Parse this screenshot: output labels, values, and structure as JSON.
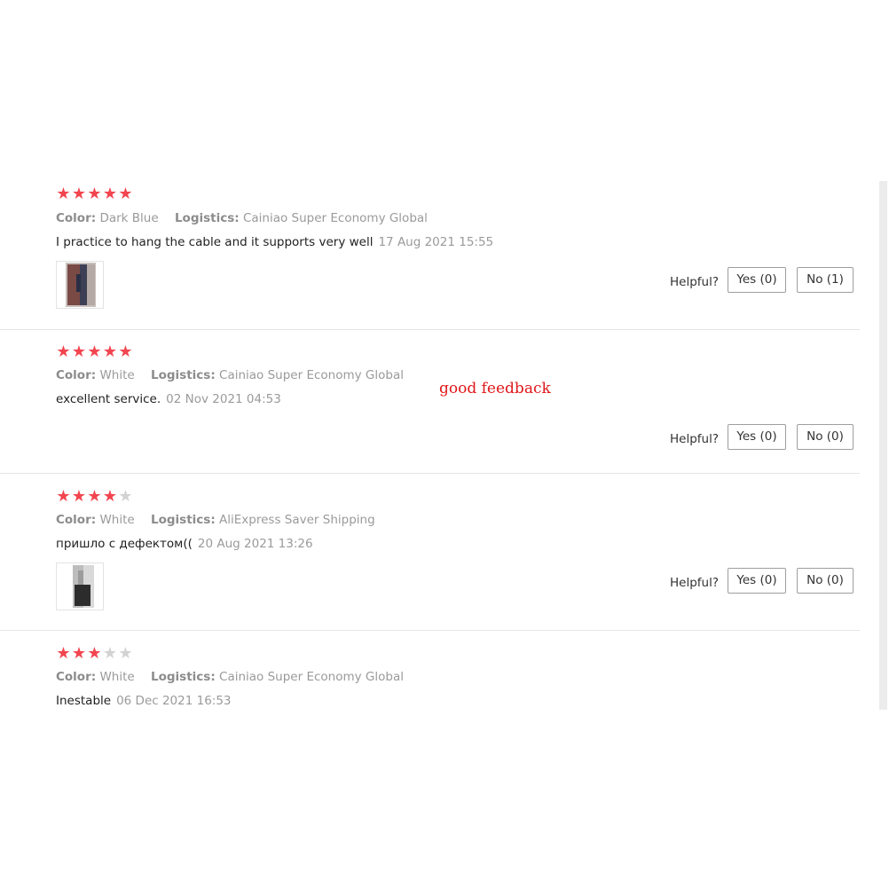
{
  "labels": {
    "color_key": "Color:",
    "logistics_key": "Logistics:",
    "helpful": "Helpful?"
  },
  "annotation": "good feedback",
  "colors": {
    "star_on": "#f2454f",
    "star_off": "#d2d2d2",
    "annotation": "#e0161a"
  },
  "reviews": [
    {
      "rating": 5,
      "color": "Dark Blue",
      "logistics": "Cainiao Super Economy Global",
      "text": "I practice to hang the cable and it supports very well",
      "date": "17 Aug 2021 15:55",
      "has_photo": true,
      "yes_label": "Yes (0)",
      "no_label": "No (1)"
    },
    {
      "rating": 5,
      "color": "White",
      "logistics": "Cainiao Super Economy Global",
      "text": "excellent service.",
      "date": "02 Nov 2021 04:53",
      "has_photo": false,
      "yes_label": "Yes (0)",
      "no_label": "No (0)"
    },
    {
      "rating": 4,
      "color": "White",
      "logistics": "AliExpress Saver Shipping",
      "text": "пришло с дефектом((",
      "date": "20 Aug 2021 13:26",
      "has_photo": true,
      "yes_label": "Yes (0)",
      "no_label": "No (0)"
    },
    {
      "rating": 3,
      "color": "White",
      "logistics": "Cainiao Super Economy Global",
      "text": "Inestable",
      "date": "06 Dec 2021 16:53",
      "has_photo": false
    }
  ]
}
